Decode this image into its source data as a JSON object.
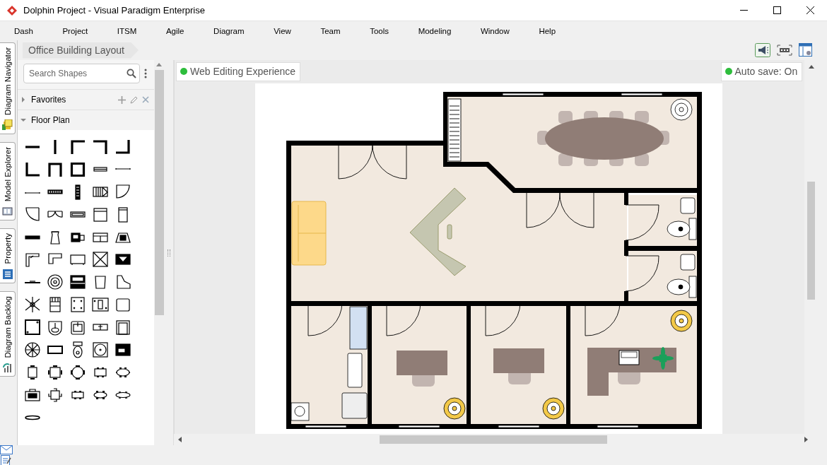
{
  "window": {
    "title": "Dolphin Project - Visual Paradigm Enterprise"
  },
  "menu": [
    "Dash",
    "Project",
    "ITSM",
    "Agile",
    "Diagram",
    "View",
    "Team",
    "Tools",
    "Modeling",
    "Window",
    "Help"
  ],
  "side_tabs": [
    {
      "label": "Diagram Navigator",
      "kind": "navigator"
    },
    {
      "label": "Model Explorer",
      "kind": "explorer"
    },
    {
      "label": "Property",
      "kind": "property"
    },
    {
      "label": "Diagram Backlog",
      "kind": "backlog"
    }
  ],
  "breadcrumb": [
    "Office Building Layout"
  ],
  "palette": {
    "search": {
      "placeholder": "Search Shapes"
    },
    "groups": [
      {
        "label": "Favorites",
        "expanded": false
      },
      {
        "label": "Floor Plan",
        "expanded": true
      }
    ]
  },
  "canvas": {
    "edit_badge": "Web Editing Experience",
    "autosave": "Auto save: On",
    "autosave_on": true
  }
}
